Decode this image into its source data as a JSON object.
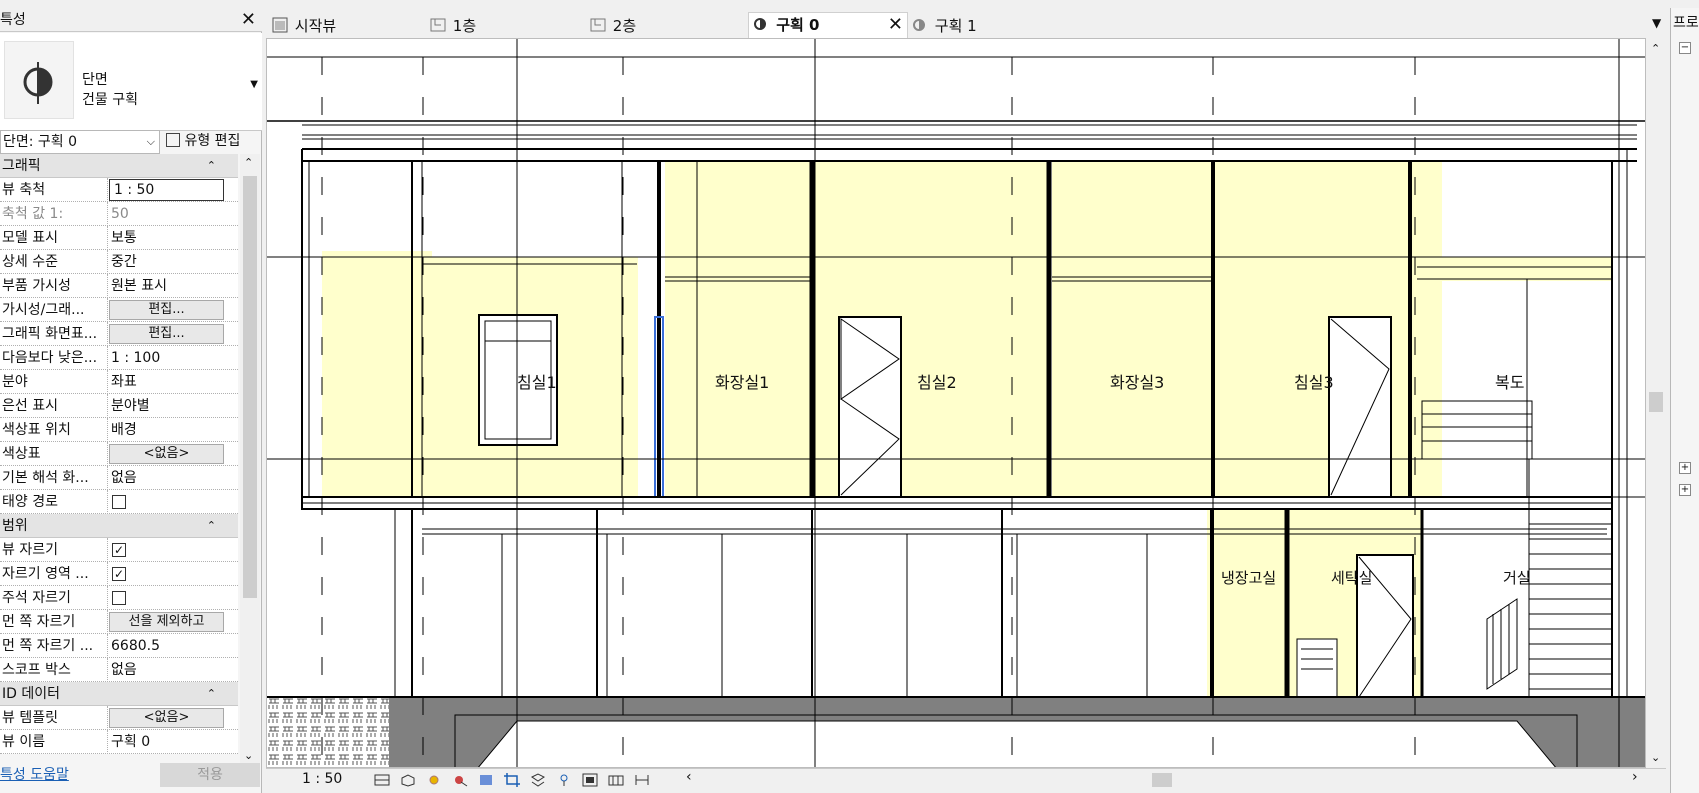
{
  "properties": {
    "title": "특성",
    "type_line1": "단면",
    "type_line2": "건물 구획",
    "selector": "단면: 구획 0",
    "edit_type": "유형 편집",
    "groups": {
      "graphics": "그래픽",
      "extents": "범위",
      "identity": "ID 데이터"
    },
    "rows": {
      "view_scale_k": "뷰 축척",
      "view_scale_v": "1 : 50",
      "scale_value_k": "축척 값    1:",
      "scale_value_v": "50",
      "model_display_k": "모델 표시",
      "model_display_v": "보통",
      "detail_level_k": "상세 수준",
      "detail_level_v": "중간",
      "parts_vis_k": "부품 가시성",
      "parts_vis_v": "원본 표시",
      "vg_k": "가시성/그래...",
      "vg_v": "편집...",
      "gdo_k": "그래픽 화면표...",
      "gdo_v": "편집...",
      "hide_scale_k": "다음보다 낮은...",
      "hide_scale_v": "1 : 100",
      "discipline_k": "분야",
      "discipline_v": "좌표",
      "hidden_lines_k": "은선 표시",
      "hidden_lines_v": "분야별",
      "color_loc_k": "색상표 위치",
      "color_loc_v": "배경",
      "color_scheme_k": "색상표",
      "color_scheme_v": "<없음>",
      "analysis_k": "기본 해석 화...",
      "analysis_v": "없음",
      "sun_path_k": "태양 경로",
      "crop_view_k": "뷰 자르기",
      "crop_region_k": "자르기 영역 ...",
      "annotation_crop_k": "주석 자르기",
      "far_clip_k": "먼 쪽 자르기",
      "far_clip_v": "선을 제외하고",
      "far_clip_offset_k": "먼 쪽 자르기 ...",
      "far_clip_offset_v": "6680.5",
      "scope_box_k": "스코프 박스",
      "scope_box_v": "없음",
      "view_template_k": "뷰 템플릿",
      "view_template_v": "<없음>",
      "view_name_k": "뷰 이름",
      "view_name_v": "구획 0"
    },
    "help_link": "특성 도움말",
    "apply": "적용"
  },
  "tabs": [
    {
      "label": "시작뷰"
    },
    {
      "label": "1층"
    },
    {
      "label": "2층"
    },
    {
      "label": "구획 0"
    },
    {
      "label": "구획 1"
    }
  ],
  "project_browser": {
    "title": "프로"
  },
  "rooms": {
    "bed1": "침실1",
    "bath1": "화장실1",
    "bed2": "침실2",
    "bath3": "화장실3",
    "bed3": "침실3",
    "hall": "복도",
    "fridge": "냉장고실",
    "laundry": "세탁실",
    "living": "거실"
  },
  "view_control": {
    "scale": "1 : 50"
  },
  "colors": {
    "room_fill": "#ffffcc",
    "ground": "#808080",
    "accent": "#1a5fb4"
  }
}
